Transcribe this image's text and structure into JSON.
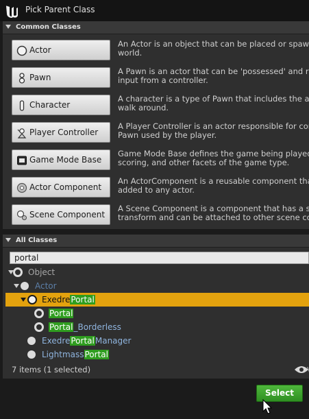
{
  "window": {
    "title": "Pick Parent Class"
  },
  "common_classes": {
    "header": "Common Classes",
    "items": [
      {
        "label": "Actor",
        "icon": "actor-icon",
        "desc1": "An Actor is an object that can be placed or spawned",
        "desc2": "world."
      },
      {
        "label": "Pawn",
        "icon": "pawn-icon",
        "desc1": "A Pawn is an actor that can be 'possessed' and rece",
        "desc2": "input from a controller."
      },
      {
        "label": "Character",
        "icon": "character-icon",
        "desc1": "A character is a type of Pawn that includes the abilit",
        "desc2": "walk around."
      },
      {
        "label": "Player Controller",
        "icon": "player-controller-icon",
        "desc1": "A Player Controller is an actor responsible for contro",
        "desc2": "Pawn used by the player."
      },
      {
        "label": "Game Mode Base",
        "icon": "game-mode-icon",
        "desc1": "Game Mode Base defines the game being played, its",
        "desc2": "scoring, and other facets of the game type."
      },
      {
        "label": "Actor Component",
        "icon": "actor-component-icon",
        "desc1": "An ActorComponent is a reusable component that c",
        "desc2": "added to any actor."
      },
      {
        "label": "Scene Component",
        "icon": "scene-component-icon",
        "desc1": "A Scene Component is a component that has a scen",
        "desc2": "transform and can be attached to other scene comp"
      }
    ]
  },
  "all_classes": {
    "header": "All Classes",
    "search_value": "portal",
    "tree": [
      {
        "pre": "Object",
        "match": "",
        "post": ""
      },
      {
        "pre": "Actor",
        "match": "",
        "post": ""
      },
      {
        "pre": "Exedre",
        "match": "Portal",
        "post": ""
      },
      {
        "pre": "",
        "match": "Portal",
        "post": ""
      },
      {
        "pre": "",
        "match": "Portal",
        "post": "_Borderless"
      },
      {
        "pre": "Exedre",
        "match": "Portal",
        "post": "Manager"
      },
      {
        "pre": "Lightmass",
        "match": "Portal",
        "post": ""
      }
    ],
    "status": "7 items (1 selected)",
    "view_options_trunc": "V"
  },
  "footer": {
    "select_label": "Select"
  },
  "colors": {
    "selection": "#e3a20e",
    "match_highlight": "#2f9d1f",
    "select_button": "#3ea52e",
    "link_blue": "#8fb4de"
  }
}
